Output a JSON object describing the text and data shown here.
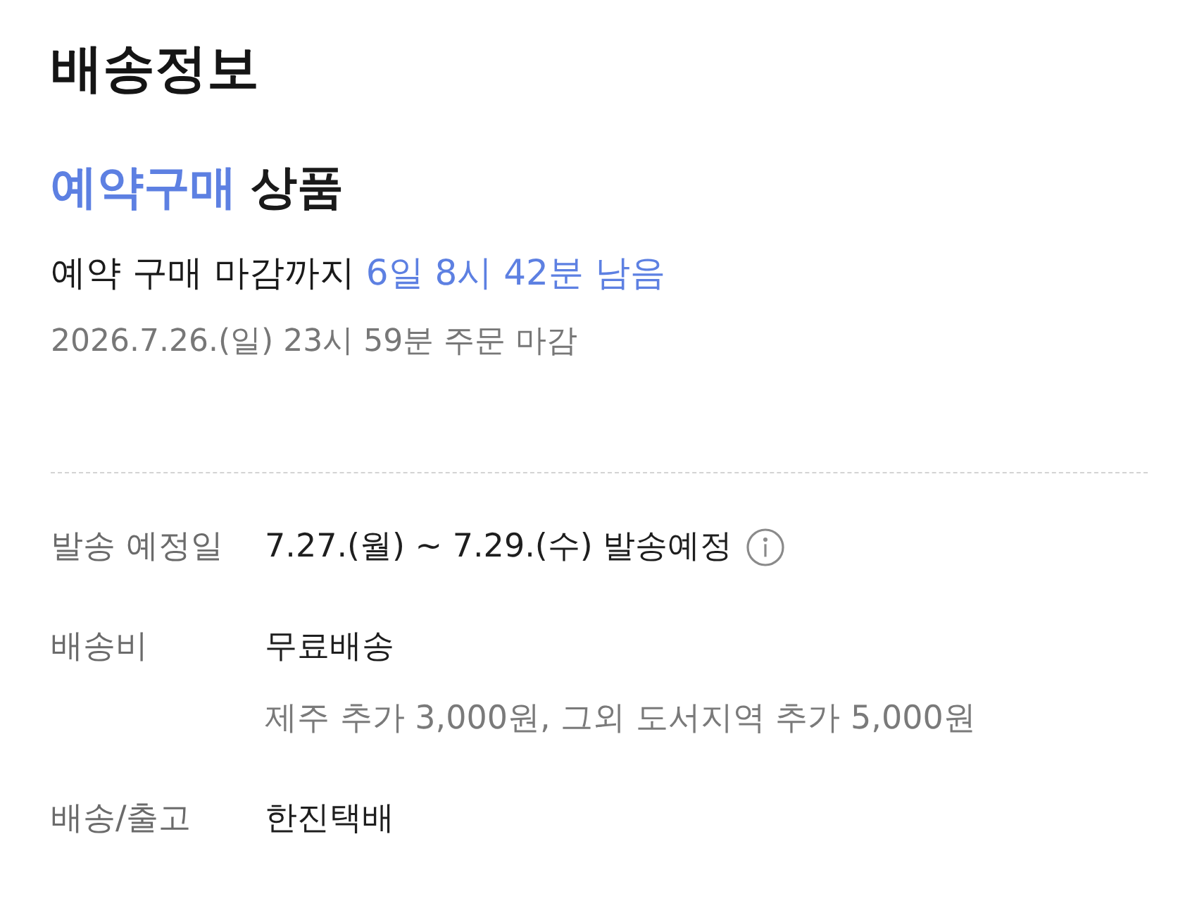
{
  "title": "배송정보",
  "product_type": {
    "highlight": "예약구매",
    "text": "상품"
  },
  "deadline": {
    "text": "예약 구매 마감까지",
    "remaining": "6일 8시 42분 남음"
  },
  "order_cutoff": "2026.7.26.(일) 23시 59분 주문 마감",
  "rows": [
    {
      "kind": "info",
      "label": "발송 예정일",
      "value": "7.27.(월) ~ 7.29.(수) 발송예정"
    },
    {
      "kind": "plain",
      "label": "배송비",
      "value": "무료배송",
      "note": "제주 추가 3,000원, 그외 도서지역 추가 5,000원"
    },
    {
      "kind": "plain",
      "label": "배송/출고",
      "value": "한진택배"
    }
  ]
}
